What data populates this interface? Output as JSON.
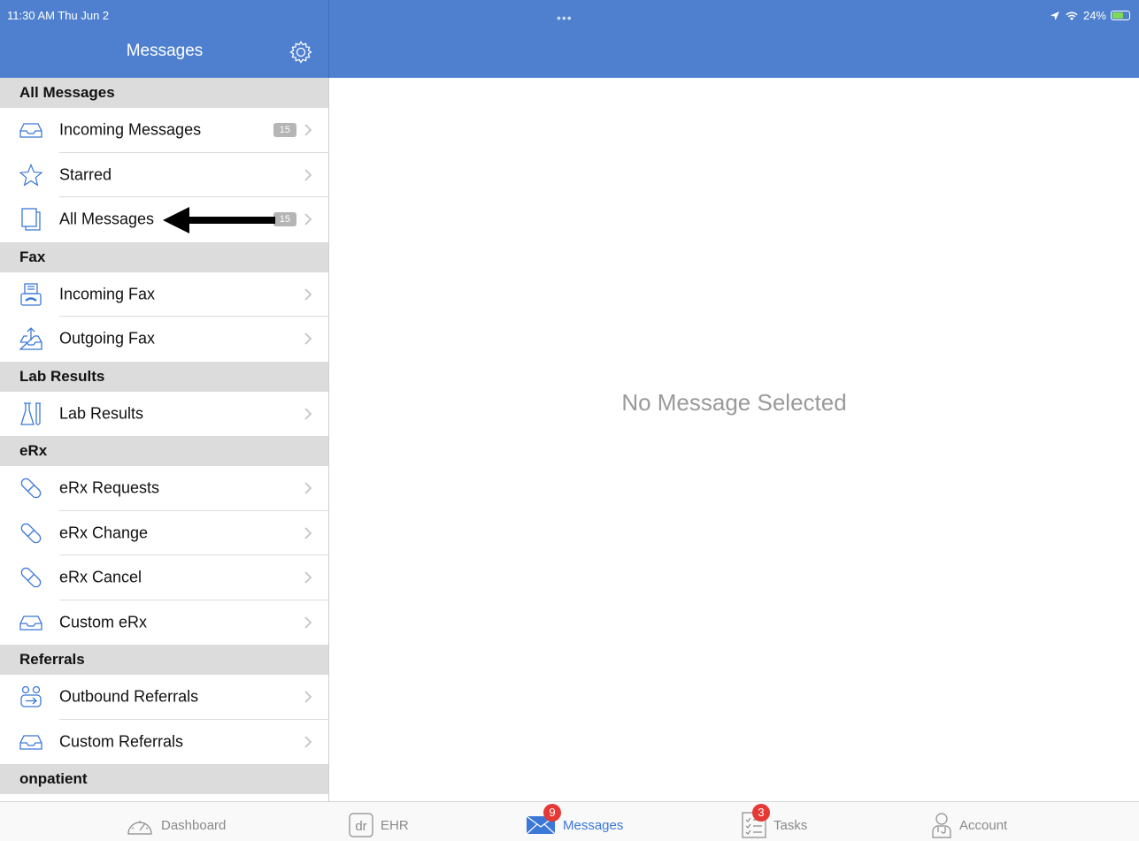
{
  "status": {
    "time": "11:30 AM  Thu Jun 2",
    "battery": "24%"
  },
  "header": {
    "title": "Messages",
    "settings_icon": "gear-icon"
  },
  "sections": [
    {
      "title": "All Messages",
      "items": [
        {
          "label": "Incoming Messages",
          "icon": "inbox-tray-icon",
          "count": "15"
        },
        {
          "label": "Starred",
          "icon": "star-icon"
        },
        {
          "label": "All Messages",
          "icon": "stacked-pages-icon",
          "count": "15"
        }
      ]
    },
    {
      "title": "Fax",
      "items": [
        {
          "label": "Incoming Fax",
          "icon": "fax-machine-icon"
        },
        {
          "label": "Outgoing Fax",
          "icon": "outbox-tray-icon"
        }
      ]
    },
    {
      "title": "Lab Results",
      "items": [
        {
          "label": "Lab Results",
          "icon": "flask-tube-icon"
        }
      ]
    },
    {
      "title": "eRx",
      "items": [
        {
          "label": "eRx Requests",
          "icon": "pill-icon"
        },
        {
          "label": "eRx Change",
          "icon": "pill-icon"
        },
        {
          "label": "eRx Cancel",
          "icon": "pill-icon"
        },
        {
          "label": "Custom eRx",
          "icon": "inbox-tray-icon"
        }
      ]
    },
    {
      "title": "Referrals",
      "items": [
        {
          "label": "Outbound Referrals",
          "icon": "people-arrow-icon"
        },
        {
          "label": "Custom Referrals",
          "icon": "inbox-tray-icon"
        }
      ]
    },
    {
      "title": "onpatient",
      "items": []
    }
  ],
  "detail": {
    "empty_text": "No Message Selected"
  },
  "tabbar": [
    {
      "label": "Dashboard",
      "icon": "speedometer-icon"
    },
    {
      "label": "EHR",
      "icon": "dr-logo-icon"
    },
    {
      "label": "Messages",
      "icon": "envelope-icon",
      "badge": "9",
      "active": true
    },
    {
      "label": "Tasks",
      "icon": "checklist-icon",
      "badge": "3"
    },
    {
      "label": "Account",
      "icon": "doctor-profile-icon"
    }
  ],
  "colors": {
    "header_blue": "#4f80cf",
    "accent": "#3b78d8",
    "badge_red": "#e53935",
    "section_grey": "#dcdcdc"
  }
}
